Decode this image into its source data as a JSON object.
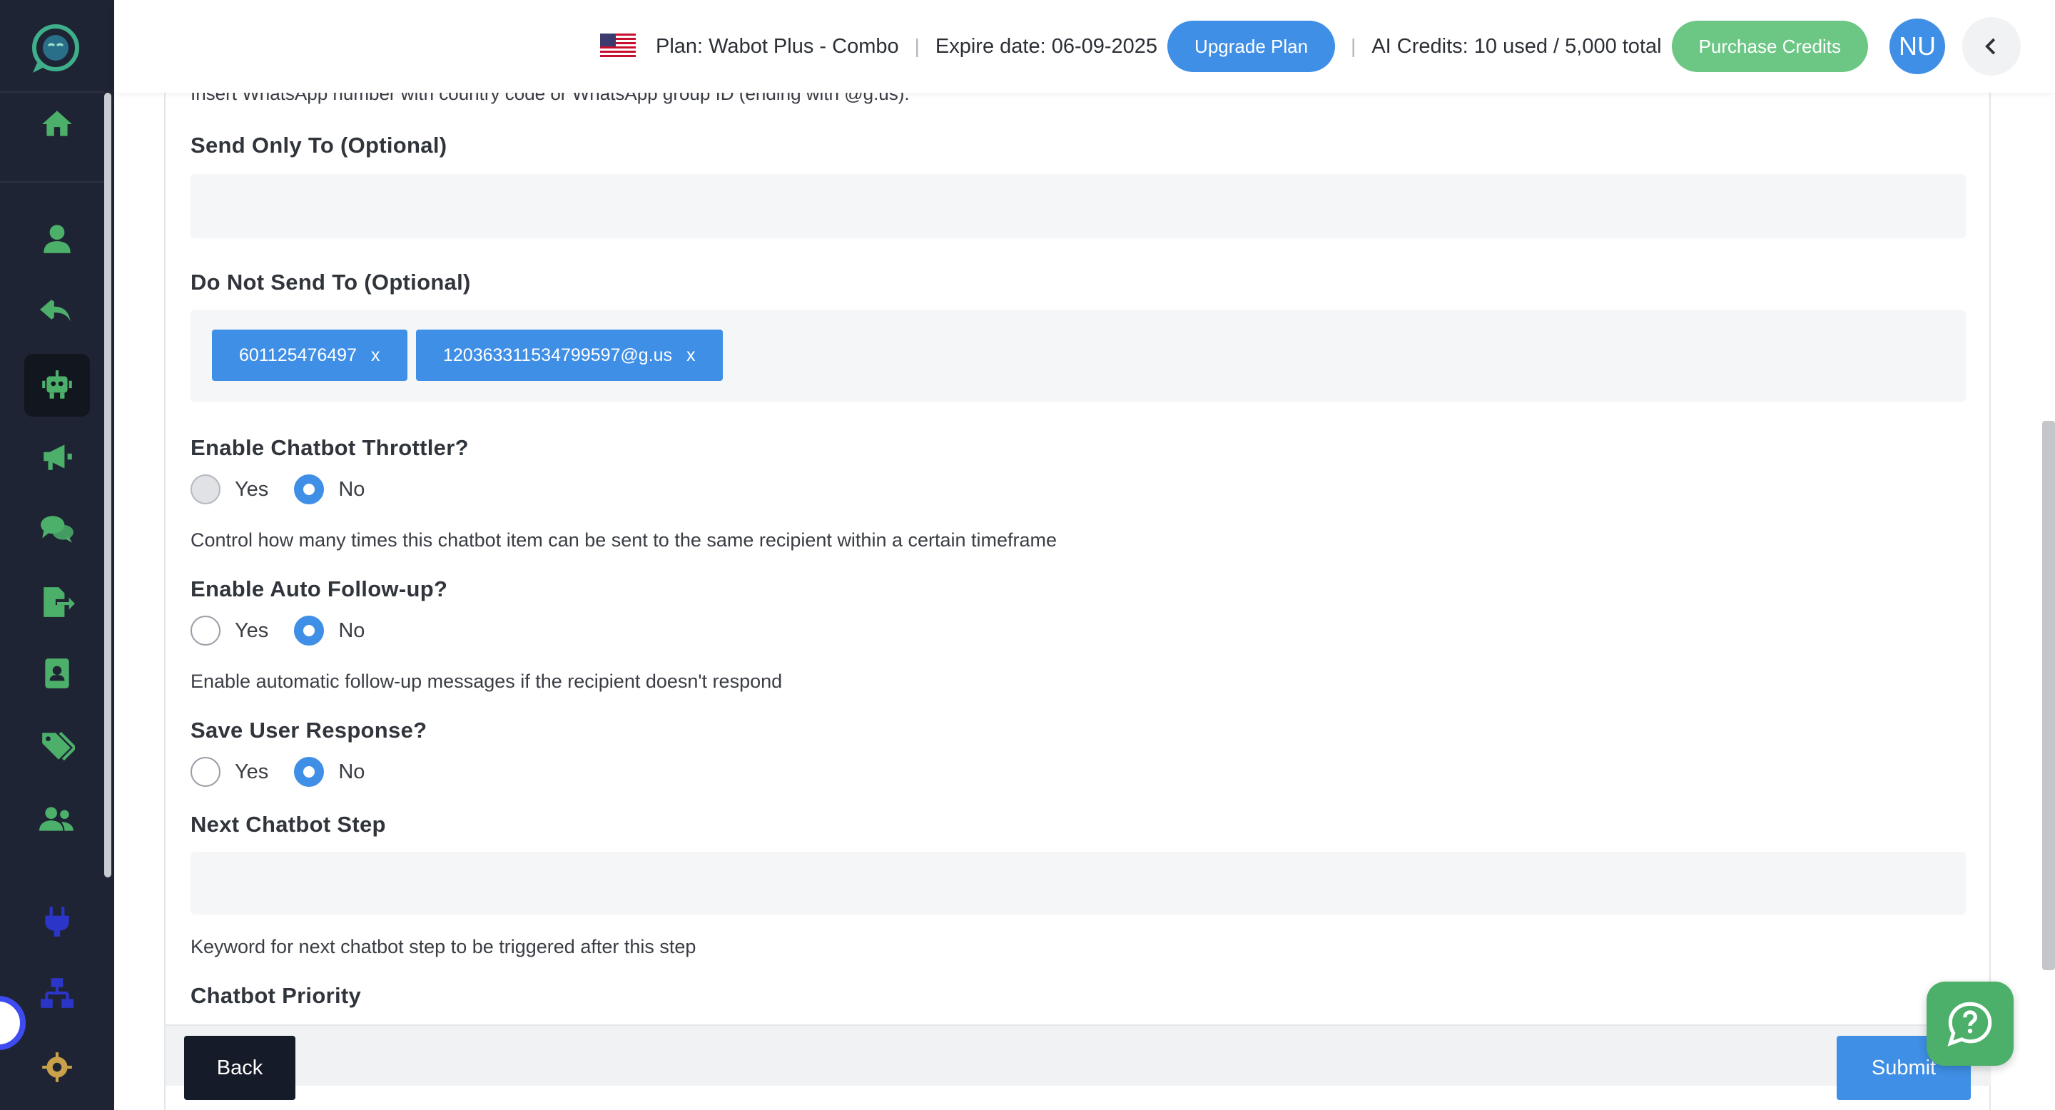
{
  "header": {
    "plan_text": "Plan: Wabot Plus - Combo",
    "sep1": "|",
    "expire_text": "Expire date: 06-09-2025",
    "upgrade_label": "Upgrade Plan",
    "sep2": "|",
    "credits_text": "AI Credits: 10 used / 5,000 total",
    "purchase_label": "Purchase Credits",
    "avatar_initials": "NU",
    "flag_icon": "us-flag-icon",
    "collapse_icon": "chevron-left-icon"
  },
  "sidebar": {
    "items": [
      {
        "icon": "home-icon",
        "color": "#4caf6a"
      },
      {
        "icon": "user-icon",
        "color": "#4caf6a"
      },
      {
        "icon": "reply-icon",
        "color": "#4caf6a"
      },
      {
        "icon": "robot-icon",
        "color": "#4caf6a",
        "active": true
      },
      {
        "icon": "megaphone-icon",
        "color": "#4caf6a"
      },
      {
        "icon": "chat-icon",
        "color": "#4caf6a"
      },
      {
        "icon": "export-icon",
        "color": "#4caf6a"
      },
      {
        "icon": "contact-book-icon",
        "color": "#4caf6a"
      },
      {
        "icon": "tags-icon",
        "color": "#4caf6a"
      },
      {
        "icon": "users-icon",
        "color": "#4caf6a"
      },
      {
        "icon": "plug-icon",
        "color": "#2b36c9"
      },
      {
        "icon": "sitemap-icon",
        "color": "#2b36c9"
      },
      {
        "icon": "settings-icon",
        "color": "#c8a14a"
      }
    ]
  },
  "form": {
    "top_hint": "Insert WhatsApp number with country code or WhatsApp group ID (ending with @g.us).",
    "send_only_to": {
      "label": "Send Only To (Optional)",
      "value": ""
    },
    "do_not_send_to": {
      "label": "Do Not Send To (Optional)",
      "tags": [
        "601125476497",
        "120363311534799597@g.us"
      ],
      "remove_glyph": "x"
    },
    "throttler": {
      "label": "Enable Chatbot Throttler?",
      "yes": "Yes",
      "no": "No",
      "selected": "No",
      "help": "Control how many times this chatbot item can be sent to the same recipient within a certain timeframe"
    },
    "auto_followup": {
      "label": "Enable Auto Follow-up?",
      "yes": "Yes",
      "no": "No",
      "selected": "No",
      "help": "Enable automatic follow-up messages if the recipient doesn't respond"
    },
    "save_response": {
      "label": "Save User Response?",
      "yes": "Yes",
      "no": "No",
      "selected": "No"
    },
    "next_step": {
      "label": "Next Chatbot Step",
      "value": "",
      "help": "Keyword for next chatbot step to be triggered after this step"
    },
    "priority": {
      "label": "Chatbot Priority"
    }
  },
  "footer": {
    "back_label": "Back",
    "submit_label": "Submit"
  },
  "help_widget": {
    "icon": "question-chat-icon",
    "color": "#4caf6a"
  }
}
